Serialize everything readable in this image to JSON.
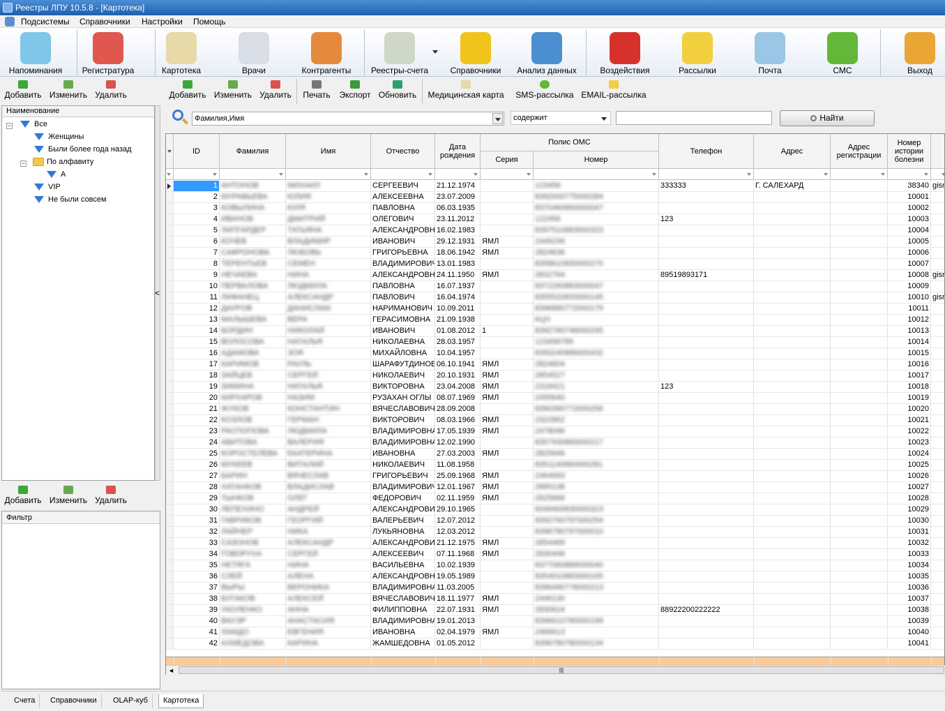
{
  "window": {
    "title": "Реестры ЛПУ 10.5.8 - [Картотека]"
  },
  "menu": [
    "Подсистемы",
    "Справочники",
    "Настройки",
    "Помощь"
  ],
  "ribbon": [
    {
      "label": "Напоминания",
      "icon": "alarm-clock-icon",
      "color": "#7fc6e8"
    },
    {
      "label": "Регистратура",
      "icon": "receptionist-icon",
      "color": "#e0574f"
    },
    {
      "label": "Картотека",
      "icon": "card-file-icon",
      "color": "#e8d9a8"
    },
    {
      "label": "Врачи",
      "icon": "doctor-icon",
      "color": "#d9dde6"
    },
    {
      "label": "Контрагенты",
      "icon": "people-icon",
      "color": "#e58a3c"
    },
    {
      "label": "Реестры-счета",
      "icon": "registry-sheet-icon",
      "color": "#cfd8c8"
    },
    {
      "label": "Справочники",
      "icon": "books-icon",
      "color": "#f0c41a"
    },
    {
      "label": "Анализ данных",
      "icon": "rubik-cube-icon",
      "color": "#4b8fd1"
    },
    {
      "label": "Воздействия",
      "icon": "sale-tag-icon",
      "color": "#d6322b"
    },
    {
      "label": "Рассылки",
      "icon": "envelope-icon",
      "color": "#f2cf3e"
    },
    {
      "label": "Почта",
      "icon": "mail-tray-icon",
      "color": "#9cc6e6"
    },
    {
      "label": "СМС",
      "icon": "sms-bubble-icon",
      "color": "#63b83a"
    },
    {
      "label": "Выход",
      "icon": "exit-door-icon",
      "color": "#e9a634"
    }
  ],
  "left_toolbar": {
    "add": "Добавить",
    "edit": "Изменить",
    "delete": "Удалить"
  },
  "tree": {
    "header": "Наименование",
    "root": "Все",
    "items": [
      "Женщины",
      "Были более года назад",
      "По алфавиту",
      "А",
      "VIP",
      "Не были совсем"
    ]
  },
  "filter_toolbar": {
    "add": "Добавить",
    "edit": "Изменить",
    "delete": "Удалить"
  },
  "filter": {
    "header": "Фильтр"
  },
  "main_toolbar": {
    "add": "Добавить",
    "edit": "Изменить",
    "delete": "Удалить",
    "print": "Печать",
    "export": "Экспорт",
    "refresh": "Обновить",
    "medcard": "Медицинская карта",
    "sms": "SMS-рассылка",
    "email": "EMAIL-рассылка"
  },
  "search": {
    "field": "Фамилия,Имя",
    "op": "содержит",
    "value": "",
    "button": "Найти"
  },
  "columns": {
    "id": "ID",
    "last": "Фамилия",
    "first": "Имя",
    "patr": "Отчество",
    "dob": "Дата рождения",
    "oms": "Полис ОМС",
    "series": "Серия",
    "number": "Номер",
    "phone": "Телефон",
    "addr": "Адрес",
    "reg": "Адрес регистрации",
    "hist": "Номер истории болезни"
  },
  "rows": [
    {
      "id": "1",
      "last": "АНТОНОВ",
      "first": "МИХАИЛ",
      "patr": "СЕРГЕЕВИЧ",
      "dob": "21.12.1974",
      "ser": "",
      "num": "123456",
      "phone": "333333",
      "addr": "Г. САЛЕХАРД",
      "hist": "38340",
      "extra": "gisr"
    },
    {
      "id": "2",
      "last": "МУРАВЬЕВА",
      "first": "ЮЛИЯ",
      "patr": "АЛЕКСЕЕВНА",
      "dob": "23.07.2009",
      "ser": "",
      "num": "8392000775000284",
      "phone": "",
      "addr": "",
      "hist": "10001",
      "extra": ""
    },
    {
      "id": "3",
      "last": "КОВЫЛИНА",
      "first": "ЮЛЯ",
      "patr": "ПАВЛОВНА",
      "dob": "06.03.1935",
      "ser": "",
      "num": "8370460893000047",
      "phone": "",
      "addr": "",
      "hist": "10002",
      "extra": ""
    },
    {
      "id": "4",
      "last": "ИВАНОВ",
      "first": "ДМИТРИЙ",
      "patr": "ОЛЕГОВИЧ",
      "dob": "23.11.2012",
      "ser": "",
      "num": "122456",
      "phone": "123",
      "addr": "",
      "hist": "10003",
      "extra": ""
    },
    {
      "id": "5",
      "last": "ЛИПГАРДЕР",
      "first": "ТАТЬЯНА",
      "patr": "АЛЕКСАНДРОВНА",
      "dob": "16.02.1983",
      "ser": "",
      "num": "8397510883000323",
      "phone": "",
      "addr": "",
      "hist": "10004",
      "extra": ""
    },
    {
      "id": "6",
      "last": "КОЧЕВ",
      "first": "ВЛАДИМИР",
      "patr": "ИВАНОВИЧ",
      "dob": "29.12.1931",
      "ser": "ЯМЛ",
      "num": "2449156",
      "phone": "",
      "addr": "",
      "hist": "10005",
      "extra": ""
    },
    {
      "id": "7",
      "last": "САФРОНОВА",
      "first": "ЛЮБОВЬ",
      "patr": "ГРИГОРЬЕВНА",
      "dob": "18.06.1942",
      "ser": "ЯМЛ",
      "num": "2824636",
      "phone": "",
      "addr": "",
      "hist": "10006",
      "extra": ""
    },
    {
      "id": "8",
      "last": "ТЕРЕНТЬЕВ",
      "first": "СЕМЁН",
      "patr": "ВЛАДИМИРОВИЧ",
      "dob": "13.01.1983",
      "ser": "",
      "num": "8358610830000270",
      "phone": "",
      "addr": "",
      "hist": "10007",
      "extra": ""
    },
    {
      "id": "9",
      "last": "НЕЧАЕВА",
      "first": "НИНА",
      "patr": "АЛЕКСАНДРОВНА",
      "dob": "24.11.1950",
      "ser": "ЯМЛ",
      "num": "2832764",
      "phone": "89519893171",
      "addr": "",
      "hist": "10008",
      "extra": "gisr"
    },
    {
      "id": "10",
      "last": "ПЕРВАЛОВА",
      "first": "ЛЮДМИЛА",
      "patr": "ПАВЛОВНА",
      "dob": "16.07.1937",
      "ser": "",
      "num": "8372260883000047",
      "phone": "",
      "addr": "",
      "hist": "10009",
      "extra": ""
    },
    {
      "id": "11",
      "last": "ЛИФАНЕЦ",
      "first": "АЛЕКСАНДР",
      "patr": "ПАВЛОВИЧ",
      "dob": "16.04.1974",
      "ser": "",
      "num": "8355520833000145",
      "phone": "",
      "addr": "",
      "hist": "10010",
      "extra": "gisr"
    },
    {
      "id": "12",
      "last": "ДАУРОВ",
      "first": "ДАНИСЛАМ",
      "patr": "НАРИМАНОВИЧ",
      "dob": "10.09.2011",
      "ser": "",
      "num": "8396880772000179",
      "phone": "",
      "addr": "",
      "hist": "10011",
      "extra": ""
    },
    {
      "id": "13",
      "last": "МАЛЫШЕВА",
      "first": "ВЕРА",
      "patr": "ГЕРАСИМОВНА",
      "dob": "21.09.1938",
      "ser": "",
      "num": "КЦЧ",
      "phone": "",
      "addr": "",
      "hist": "10012",
      "extra": ""
    },
    {
      "id": "14",
      "last": "БОРДИН",
      "first": "НИКОЛАЙ",
      "patr": "ИВАНОВИЧ",
      "dob": "01.08.2012",
      "ser": "1",
      "num": "8392760748000245",
      "phone": "",
      "addr": "",
      "hist": "10013",
      "extra": ""
    },
    {
      "id": "15",
      "last": "ВОЛОСОВА",
      "first": "НАТАЛЬЯ",
      "patr": "НИКОЛАЕВНА",
      "dob": "28.03.1957",
      "ser": "",
      "num": "123456789",
      "phone": "",
      "addr": "",
      "hist": "10014",
      "extra": ""
    },
    {
      "id": "16",
      "last": "АДАМОВА",
      "first": "ЗОЯ",
      "patr": "МИХАЙЛОВНА",
      "dob": "10.04.1957",
      "ser": "",
      "num": "8350240889000432",
      "phone": "",
      "addr": "",
      "hist": "10015",
      "extra": ""
    },
    {
      "id": "17",
      "last": "КАРИМОВ",
      "first": "РАУЛЬ",
      "patr": "ШАРАФУТДИНОВИЧ",
      "dob": "06.10.1941",
      "ser": "ЯМЛ",
      "num": "2824804",
      "phone": "",
      "addr": "",
      "hist": "10016",
      "extra": ""
    },
    {
      "id": "18",
      "last": "ЗАЙЦЕВ",
      "first": "СЕРГЕЙ",
      "patr": "НИКОЛАЕВИЧ",
      "dob": "20.10.1931",
      "ser": "ЯМЛ",
      "num": "2854527",
      "phone": "",
      "addr": "",
      "hist": "10017",
      "extra": ""
    },
    {
      "id": "19",
      "last": "ЗИМИНА",
      "first": "НАТАЛЬЯ",
      "patr": "ВИКТОРОВНА",
      "dob": "23.04.2008",
      "ser": "ЯМЛ",
      "num": "2318421",
      "phone": "123",
      "addr": "",
      "hist": "10018",
      "extra": ""
    },
    {
      "id": "20",
      "last": "КИРХАРОВ",
      "first": "НАЗИМ",
      "patr": "РУЗАХАН ОГЛЫ",
      "dob": "08.07.1969",
      "ser": "ЯМЛ",
      "num": "2455640",
      "phone": "",
      "addr": "",
      "hist": "10019",
      "extra": ""
    },
    {
      "id": "21",
      "last": "ЖУКОВ",
      "first": "КОНСТАНТИН",
      "patr": "ВЯЧЕСЛАВОВИЧ",
      "dob": "28.09.2008",
      "ser": "",
      "num": "8390390772000256",
      "phone": "",
      "addr": "",
      "hist": "10020",
      "extra": ""
    },
    {
      "id": "22",
      "last": "КОЗЛОВ",
      "first": "ГЕРМАН",
      "patr": "ВИКТОРОВИЧ",
      "dob": "08.03.1966",
      "ser": "ЯМЛ",
      "num": "2322862",
      "phone": "",
      "addr": "",
      "hist": "10021",
      "extra": ""
    },
    {
      "id": "23",
      "last": "РАСПОПОВА",
      "first": "ЛЮДМИЛА",
      "patr": "ВЛАДИМИРОВНА",
      "dob": "17.05.1939",
      "ser": "ЯМЛ",
      "num": "2478096",
      "phone": "",
      "addr": "",
      "hist": "10022",
      "extra": ""
    },
    {
      "id": "24",
      "last": "АВИТОВА",
      "first": "ВАЛЕРИЯ",
      "patr": "ВЛАДИМИРОВНА",
      "dob": "12.02.1990",
      "ser": "",
      "num": "8357930883000217",
      "phone": "",
      "addr": "",
      "hist": "10023",
      "extra": ""
    },
    {
      "id": "25",
      "last": "КОРОСТЕЛЁВА",
      "first": "ЕКАТЕРИНА",
      "patr": "ИВАНОВНА",
      "dob": "27.03.2003",
      "ser": "ЯМЛ",
      "num": "2829946",
      "phone": "",
      "addr": "",
      "hist": "10024",
      "extra": ""
    },
    {
      "id": "26",
      "last": "МУКЕЕВ",
      "first": "ВИТАЛИЙ",
      "patr": "НИКОЛАЕВИЧ",
      "dob": "11.08.1958",
      "ser": "",
      "num": "8351140883000281",
      "phone": "",
      "addr": "",
      "hist": "10025",
      "extra": ""
    },
    {
      "id": "27",
      "last": "БАРИН",
      "first": "ВЯЧЕСЛАВ",
      "patr": "ГРИГОРЬЕВИЧ",
      "dob": "25.09.1968",
      "ser": "ЯМЛ",
      "num": "2464693",
      "phone": "",
      "addr": "",
      "hist": "10026",
      "extra": ""
    },
    {
      "id": "28",
      "last": "ХАТАНКОВ",
      "first": "ВЛАДИСЛАВ",
      "patr": "ВЛАДИМИРОВИЧ",
      "dob": "12.01.1967",
      "ser": "ЯМЛ",
      "num": "2865138",
      "phone": "",
      "addr": "",
      "hist": "10027",
      "extra": ""
    },
    {
      "id": "29",
      "last": "ТЫНКОВ",
      "first": "ОЛЕГ",
      "patr": "ФЕДОРОВИЧ",
      "dob": "02.11.1959",
      "ser": "ЯМЛ",
      "num": "2825866",
      "phone": "",
      "addr": "",
      "hist": "10028",
      "extra": ""
    },
    {
      "id": "30",
      "last": "ЛЕПЕХИНО",
      "first": "АНДРЕЙ",
      "patr": "АЛЕКСАНДРОВИЧ",
      "dob": "29.10.1965",
      "ser": "",
      "num": "8349400830000323",
      "phone": "",
      "addr": "",
      "hist": "10029",
      "extra": ""
    },
    {
      "id": "31",
      "last": "ГАВРИКОВ",
      "first": "ГЕОРГИЙ",
      "patr": "ВАЛЕРЬЕВИЧ",
      "dob": "12.07.2012",
      "ser": "",
      "num": "8392760797000254",
      "phone": "",
      "addr": "",
      "hist": "10030",
      "extra": ""
    },
    {
      "id": "32",
      "last": "ЛАЙНЕР",
      "first": "НИКА",
      "patr": "ЛУКЬЯНОВНА",
      "dob": "12.03.2012",
      "ser": "",
      "num": "8396780797000010",
      "phone": "",
      "addr": "",
      "hist": "10031",
      "extra": ""
    },
    {
      "id": "33",
      "last": "САЗОНОВ",
      "first": "АЛЕКСАНДР",
      "patr": "АЛЕКСАНДРОВИЧ",
      "dob": "21.12.1975",
      "ser": "ЯМЛ",
      "num": "2854469",
      "phone": "",
      "addr": "",
      "hist": "10032",
      "extra": ""
    },
    {
      "id": "34",
      "last": "ГОВОРУХА",
      "first": "СЕРГЕЙ",
      "patr": "АЛЕКСЕЕВИЧ",
      "dob": "07.11.1968",
      "ser": "ЯМЛ",
      "num": "2830446",
      "phone": "",
      "addr": "",
      "hist": "10033",
      "extra": ""
    },
    {
      "id": "35",
      "last": "НЕТЯГА",
      "first": "НИНА",
      "patr": "ВАСИЛЬЕВНА",
      "dob": "10.02.1939",
      "ser": "",
      "num": "8377060889000040",
      "phone": "",
      "addr": "",
      "hist": "10034",
      "extra": ""
    },
    {
      "id": "36",
      "last": "СЛЕЙ",
      "first": "АЛЁНА",
      "patr": "АЛЕКСАНДРОВНА",
      "dob": "19.05.1989",
      "ser": "",
      "num": "8354010883000165",
      "phone": "",
      "addr": "",
      "hist": "10035",
      "extra": ""
    },
    {
      "id": "37",
      "last": "ВЫРЫ",
      "first": "ВЕРОНИКА",
      "patr": "ВЛАДИМИРОВНА",
      "dob": "11.03.2005",
      "ser": "",
      "num": "8396490778000213",
      "phone": "",
      "addr": "",
      "hist": "10036",
      "extra": ""
    },
    {
      "id": "38",
      "last": "БУГАКОВ",
      "first": "АЛЕКСЕЙ",
      "patr": "ВЯЧЕСЛАВОВИЧ",
      "dob": "18.11.1977",
      "ser": "ЯМЛ",
      "num": "2446130",
      "phone": "",
      "addr": "",
      "hist": "10037",
      "extra": ""
    },
    {
      "id": "39",
      "last": "УКОЛЕНКО",
      "first": "АННА",
      "patr": "ФИЛИППОВНА",
      "dob": "22.07.1931",
      "ser": "ЯМЛ",
      "num": "2830624",
      "phone": "88922200222222",
      "addr": "",
      "hist": "10038",
      "extra": ""
    },
    {
      "id": "40",
      "last": "ВАУЭР",
      "first": "АНАСТАСИЯ",
      "patr": "ВЛАДИМИРОВНА",
      "dob": "19.01.2013",
      "ser": "",
      "num": "8396610780000199",
      "phone": "",
      "addr": "",
      "hist": "10039",
      "extra": ""
    },
    {
      "id": "41",
      "last": "ЛАМДО",
      "first": "ЕВГЕНИЯ",
      "patr": "ИВАНОВНА",
      "dob": "02.04.1979",
      "ser": "ЯМЛ",
      "num": "2466613",
      "phone": "",
      "addr": "",
      "hist": "10040",
      "extra": ""
    },
    {
      "id": "42",
      "last": "АХМЕДОВА",
      "first": "КАРИНА",
      "patr": "ЖАМШЕДОВНА",
      "dob": "01.05.2012",
      "ser": "",
      "num": "8396780780000134",
      "phone": "",
      "addr": "",
      "hist": "10041",
      "extra": ""
    }
  ],
  "tabs": [
    "Счета",
    "Справочники",
    "OLAP-куб",
    "Картотека"
  ]
}
